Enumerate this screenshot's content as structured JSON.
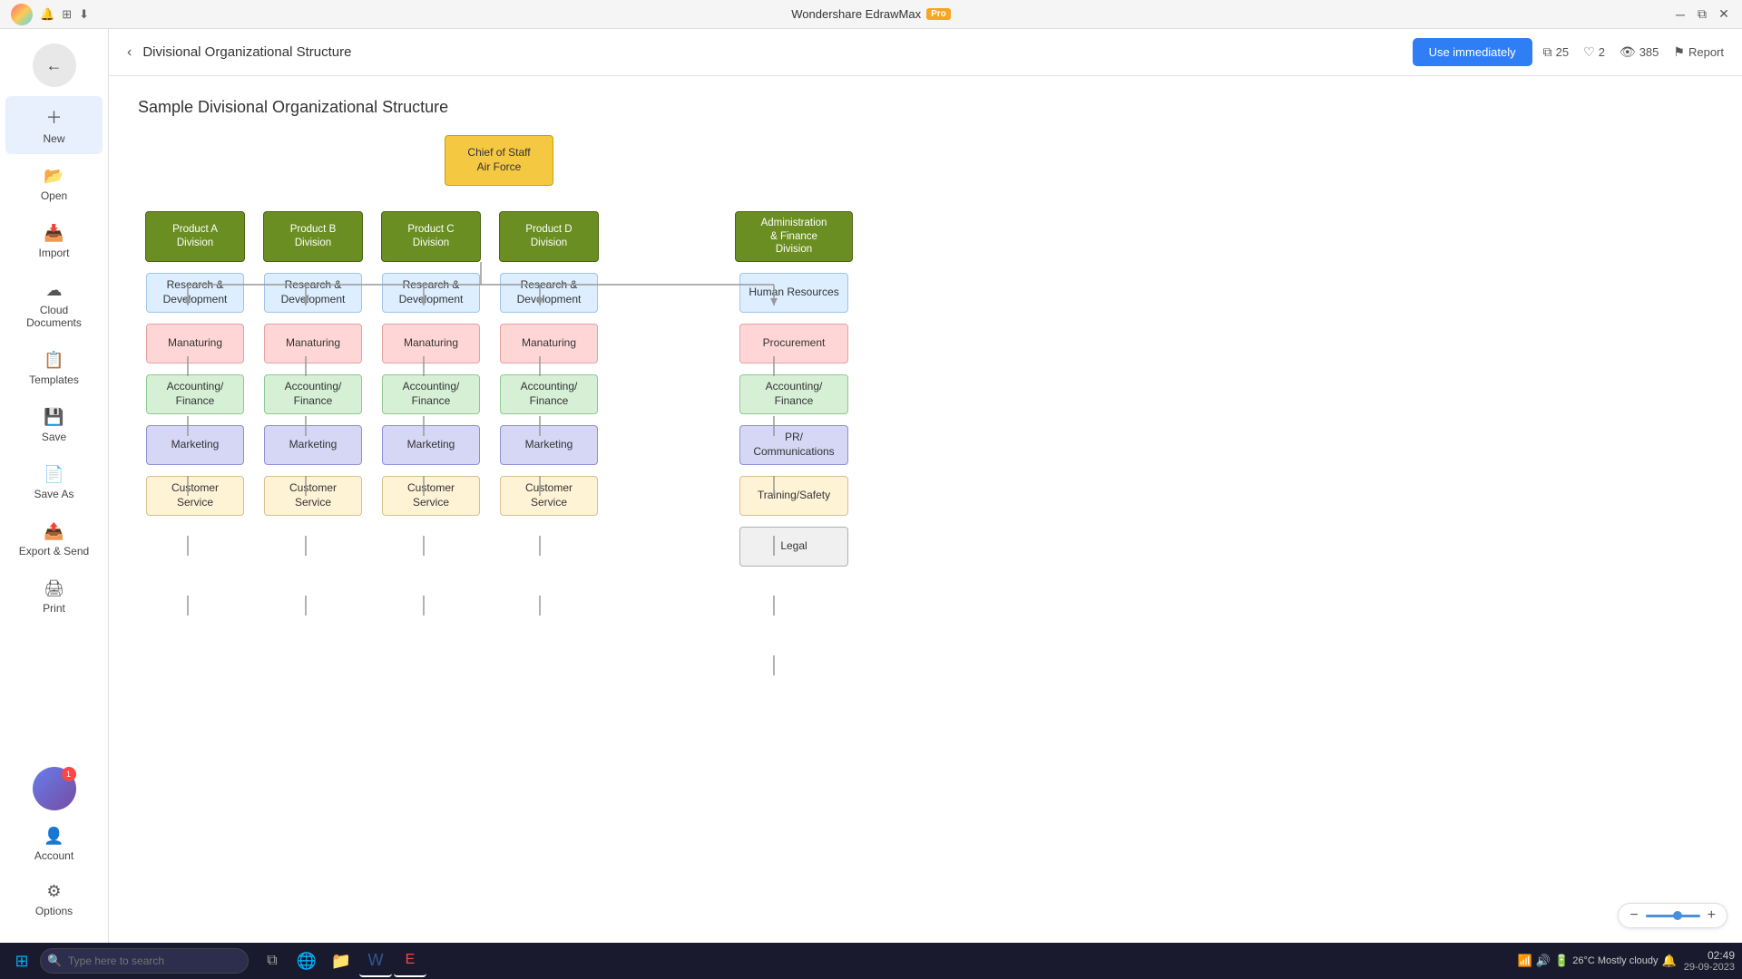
{
  "titlebar": {
    "app_name": "Wondershare EdrawMax",
    "pro_label": "Pro"
  },
  "topbar": {
    "page_title": "Divisional Organizational Structure",
    "use_immediately_label": "Use immediately",
    "stats": {
      "copies": "25",
      "likes": "2",
      "views": "385",
      "report": "Report"
    }
  },
  "sidebar": {
    "new_label": "New",
    "open_label": "Open",
    "import_label": "Import",
    "cloud_label": "Cloud Documents",
    "templates_label": "Templates",
    "save_label": "Save",
    "saveas_label": "Save As",
    "export_label": "Export & Send",
    "print_label": "Print",
    "account_label": "Account",
    "options_label": "Options"
  },
  "diagram": {
    "title": "Sample Divisional Organizational Structure",
    "chief": {
      "line1": "Chief of Staff",
      "line2": "Air Force"
    },
    "divisions": [
      {
        "label": "Product A\nDivision"
      },
      {
        "label": "Product B\nDivision"
      },
      {
        "label": "Product C\nDivision"
      },
      {
        "label": "Product D\nDivision"
      },
      {
        "label": "Administration\n& Finance\nDivision"
      }
    ],
    "departments": {
      "standard": [
        "Research &\nDevelopment",
        "Manaturing",
        "Accounting/\nFinance",
        "Marketing",
        "Customer Service"
      ],
      "admin": [
        "Human Resources",
        "Procurement",
        "Accounting/\nFinance",
        "PR/\nCommunications",
        "Training/Safety",
        "Legal"
      ]
    }
  },
  "zoom": {
    "minus": "−",
    "plus": "+"
  },
  "taskbar": {
    "search_placeholder": "Type here to search",
    "time": "02:49",
    "date": "29-09-2023",
    "weather": "26°C  Mostly cloudy"
  }
}
